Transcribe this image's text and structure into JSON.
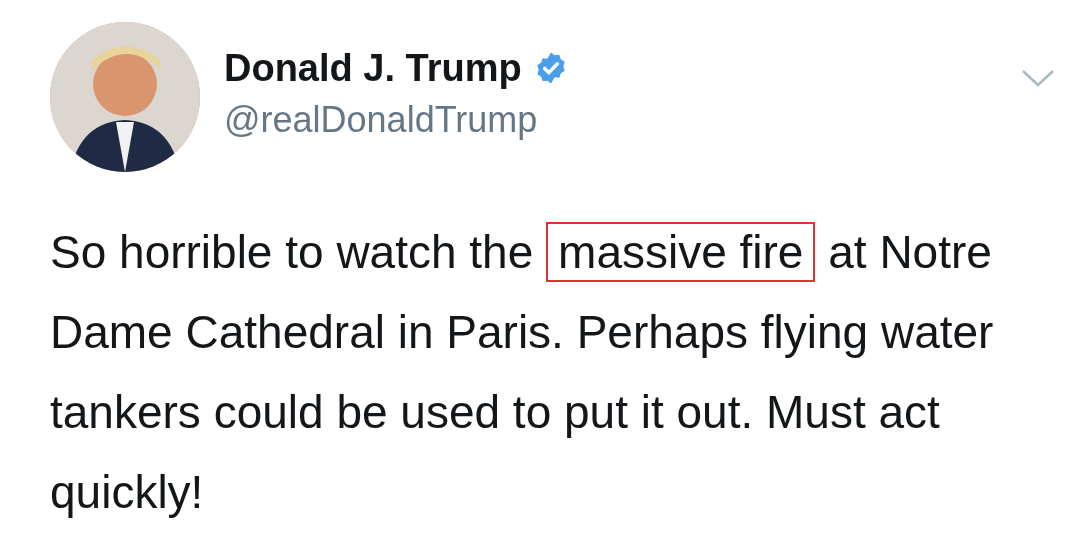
{
  "tweet": {
    "author": {
      "name": "Donald J. Trump",
      "handle": "@realDonaldTrump",
      "verified": true
    },
    "text": [
      {
        "text": "So horrible to watch the ",
        "highlighted": false
      },
      {
        "text": "massive fire",
        "highlighted": true
      },
      {
        "text": " at Notre Dame Cathedral in Paris. Perhaps flying water tankers could be used to put it out. Must act quickly!",
        "highlighted": false
      }
    ]
  }
}
